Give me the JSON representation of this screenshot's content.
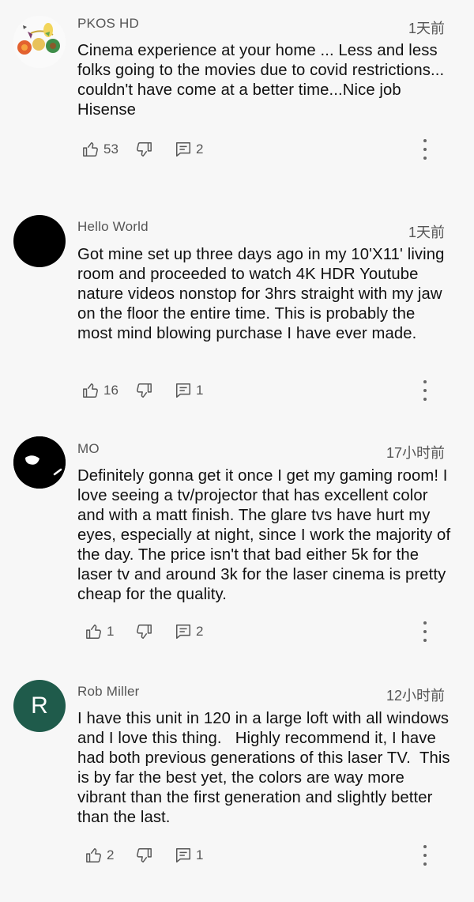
{
  "comments": [
    {
      "author": "PKOS HD",
      "time": "1天前",
      "text": "Cinema experience at your home ... Less and less folks going to the movies due to covid restrictions... couldn't have come at a better time...Nice job Hisense",
      "likes": "53",
      "replies": "2",
      "avatar": "illustrated-avatar"
    },
    {
      "author": "Hello World",
      "time": "1天前",
      "text": "Got mine set up three days ago in my 10'X11' living room and proceeded to watch 4K HDR Youtube nature videos nonstop for 3hrs straight with my jaw on the floor the entire time. This is probably the most mind blowing purchase I have ever made.",
      "likes": "16",
      "replies": "1",
      "avatar": "black-circle"
    },
    {
      "author": "MO",
      "time": "17小时前",
      "text": "Definitely gonna get it once I get my gaming room! I love seeing a tv/projector that has excellent color and with a matt finish. The glare tvs have hurt my eyes, especially at night, since I work the majority of the day. The price isn't that bad either 5k for the laser tv and around 3k for the laser cinema is pretty cheap for the quality.",
      "likes": "1",
      "replies": "2",
      "avatar": "black-face-avatar"
    },
    {
      "author": "Rob Miller",
      "time": "12小时前",
      "text": "I have this unit in 120 in a large loft with all windows and I love this thing.   Highly recommend it, I have had both previous generations of this laser TV.  This is by far the best yet, the colors are way more vibrant than the first generation and slightly better than the last.",
      "likes": "2",
      "replies": "1",
      "avatar_letter": "R",
      "avatar_color": "#1f5b4b"
    }
  ]
}
